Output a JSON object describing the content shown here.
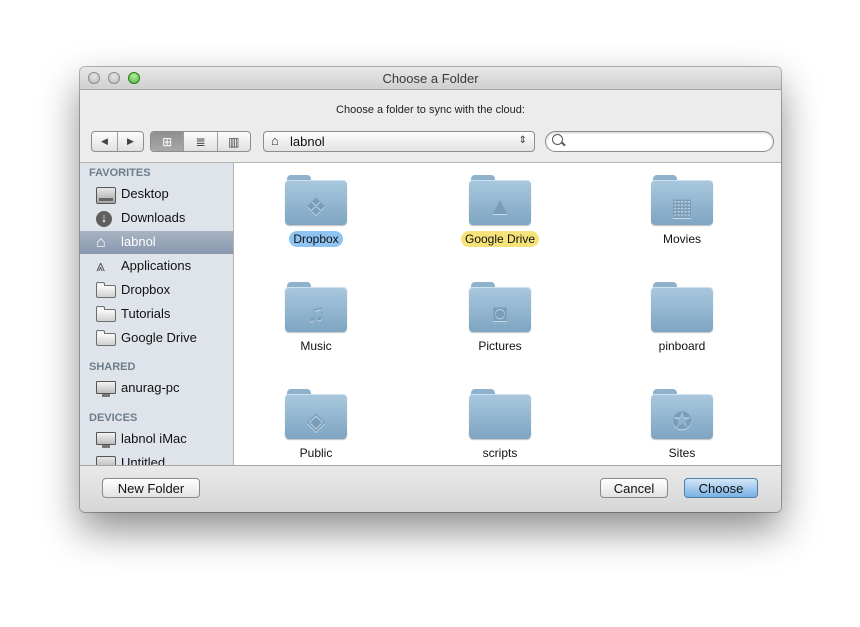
{
  "window": {
    "title": "Choose a Folder",
    "prompt": "Choose a folder to sync with the cloud:"
  },
  "toolbar": {
    "back_glyph": "◀",
    "forward_glyph": "▶",
    "view_icon_glyph": "⊞",
    "view_list_glyph": "≣",
    "view_column_glyph": "▥",
    "location": "labnol",
    "location_arrows": "⇕",
    "search_value": "",
    "search_placeholder": ""
  },
  "sidebar": {
    "favorites_header": "FAVORITES",
    "shared_header": "SHARED",
    "devices_header": "DEVICES",
    "favorites": [
      {
        "label": "Desktop",
        "icon": "desktop-icon"
      },
      {
        "label": "Downloads",
        "icon": "downloads-icon"
      },
      {
        "label": "labnol",
        "icon": "home-icon",
        "selected": true
      },
      {
        "label": "Applications",
        "icon": "applications-icon"
      },
      {
        "label": "Dropbox",
        "icon": "folder-icon"
      },
      {
        "label": "Tutorials",
        "icon": "folder-icon"
      },
      {
        "label": "Google Drive",
        "icon": "folder-icon"
      }
    ],
    "shared": [
      {
        "label": "anurag-pc",
        "icon": "network-computer-icon"
      }
    ],
    "devices": [
      {
        "label": "labnol iMac",
        "icon": "imac-icon"
      },
      {
        "label": "Untitled",
        "icon": "disk-icon"
      }
    ]
  },
  "content": {
    "items": [
      {
        "label": "Dropbox",
        "emblem": "❖",
        "tag": "blue"
      },
      {
        "label": "Google Drive",
        "emblem": "▲",
        "tag": "yellow"
      },
      {
        "label": "Movies",
        "emblem": "▦"
      },
      {
        "label": "Music",
        "emblem": "♫"
      },
      {
        "label": "Pictures",
        "emblem": "◙"
      },
      {
        "label": "pinboard",
        "emblem": ""
      },
      {
        "label": "Public",
        "emblem": "◈"
      },
      {
        "label": "scripts",
        "emblem": ""
      },
      {
        "label": "Sites",
        "emblem": "✪"
      }
    ]
  },
  "buttons": {
    "new_folder": "New Folder",
    "cancel": "Cancel",
    "choose": "Choose"
  },
  "colors": {
    "sidebar_bg": "#dee4ea",
    "selected_item": "#8697ad",
    "folder": "#93b6d1",
    "tag_blue": "#8ec3f2",
    "tag_yellow": "#f5e37a",
    "default_button": "#78b0e3"
  }
}
